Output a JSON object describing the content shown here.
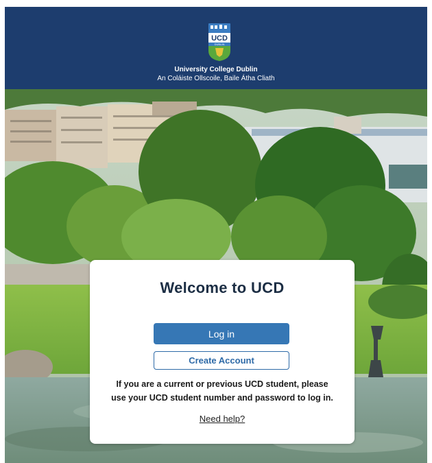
{
  "header": {
    "logo": {
      "name": "ucd-crest",
      "wordmark": "UCD",
      "sub_wordmark": "DUBLIN",
      "colors": {
        "blue": "#3a7cc2",
        "green": "#5aa83c",
        "gold": "#e8c23a"
      }
    },
    "name_en": "University College Dublin",
    "name_ga": "An Coláiste Ollscoile, Baile Átha Cliath",
    "background": "#1d3d6e"
  },
  "background_image": {
    "icon": "campus-photo"
  },
  "login_card": {
    "title": "Welcome to UCD",
    "login_label": "Log in",
    "create_account_label": "Create Account",
    "info_line1": "If you are a current or previous UCD student, please",
    "info_line2": "use your UCD student number and password to log in.",
    "help_link": "Need help?",
    "accent": "#3677b5"
  }
}
